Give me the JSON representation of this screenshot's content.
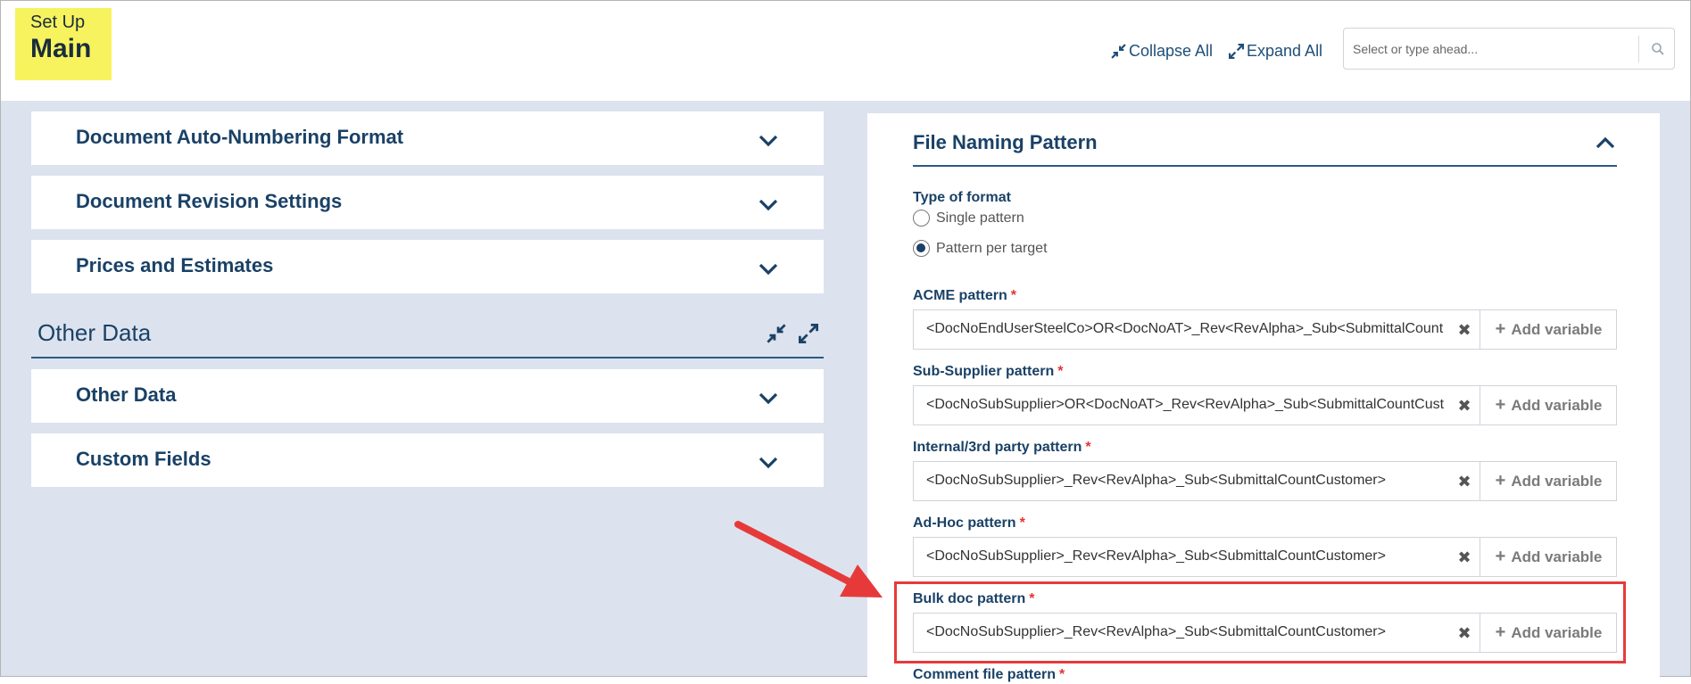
{
  "header": {
    "badge_small": "Set Up",
    "badge_big": "Main",
    "collapse_all": "Collapse All",
    "expand_all": "Expand All",
    "search_placeholder": "Select or type ahead..."
  },
  "left_panels_top": [
    {
      "title": "Document Auto-Numbering Format"
    },
    {
      "title": "Document Revision Settings"
    },
    {
      "title": "Prices and Estimates"
    }
  ],
  "other_data_section": {
    "heading": "Other Data",
    "panels": [
      {
        "title": "Other Data"
      },
      {
        "title": "Custom Fields"
      }
    ]
  },
  "file_naming": {
    "title": "File Naming Pattern",
    "type_of_format_label": "Type of format",
    "options": [
      {
        "label": "Single pattern",
        "selected": false
      },
      {
        "label": "Pattern per target",
        "selected": true
      }
    ],
    "fields": [
      {
        "label": "ACME pattern",
        "value": "<DocNoEndUserSteelCo>OR<DocNoAT>_Rev<RevAlpha>_Sub<SubmittalCountCustomer>"
      },
      {
        "label": "Sub-Supplier pattern",
        "value": "<DocNoSubSupplier>OR<DocNoAT>_Rev<RevAlpha>_Sub<SubmittalCountCustomer>"
      },
      {
        "label": "Internal/3rd party pattern",
        "value": "<DocNoSubSupplier>_Rev<RevAlpha>_Sub<SubmittalCountCustomer>"
      },
      {
        "label": "Ad-Hoc pattern",
        "value": "<DocNoSubSupplier>_Rev<RevAlpha>_Sub<SubmittalCountCustomer>"
      },
      {
        "label": "Bulk doc pattern",
        "value": "<DocNoSubSupplier>_Rev<RevAlpha>_Sub<SubmittalCountCustomer>"
      }
    ],
    "partial_label": "Comment file pattern",
    "add_variable": "Add variable",
    "required_mark": "*",
    "clear_glyph": "✖"
  },
  "colors": {
    "accent": "#1a4166",
    "badge_bg": "#f7f35e",
    "content_bg": "#dce3ee",
    "highlight": "#e63a3a"
  }
}
